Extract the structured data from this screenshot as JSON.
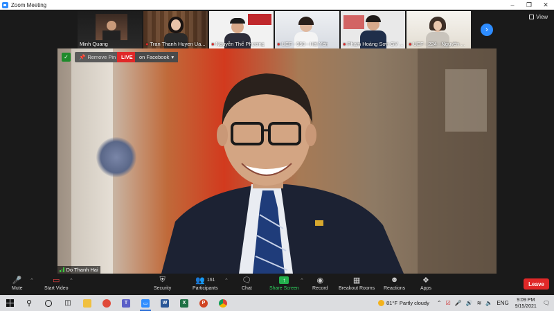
{
  "window": {
    "title": "Zoom Meeting"
  },
  "thumbnails": [
    {
      "name": "Minh Quang",
      "muted": false
    },
    {
      "name": "Tran Thanh Huyen Ua...",
      "muted": true
    },
    {
      "name": "Nguyễn Thế Phương",
      "muted": true
    },
    {
      "name": "UEF - 950 - Hải Yến",
      "muted": true
    },
    {
      "name": "Phạm Hoàng Sơn GV ...",
      "muted": true
    },
    {
      "name": "UEF - 224 - Nguyễn ...",
      "muted": true
    }
  ],
  "view": {
    "label": "View"
  },
  "main": {
    "remove_pin": "Remove Pin",
    "live": "LIVE",
    "live_destination": "on Facebook",
    "speaker": "Do Thanh Hai"
  },
  "toolbar": {
    "mute": "Mute",
    "start_video": "Start Video",
    "security": "Security",
    "participants": "Participants",
    "participants_count": "161",
    "chat": "Chat",
    "share_screen": "Share Screen",
    "record": "Record",
    "breakout_rooms": "Breakout Rooms",
    "reactions": "Reactions",
    "apps": "Apps",
    "leave": "Leave"
  },
  "taskbar": {
    "weather_temp": "81°F",
    "weather_desc": "Partly cloudy",
    "language": "ENG",
    "time": "9:09 PM",
    "date": "9/15/2021"
  },
  "colors": {
    "accent": "#2d8cff",
    "live": "#e02828",
    "share": "#23b14d",
    "leave": "#e02828"
  }
}
